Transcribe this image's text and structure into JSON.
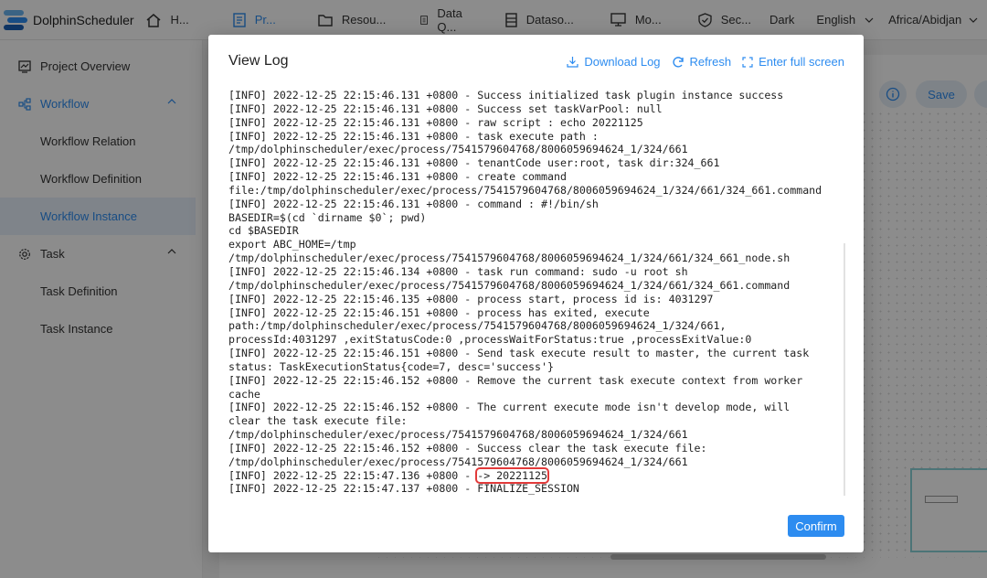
{
  "app": {
    "name": "DolphinScheduler"
  },
  "topnav": {
    "items": [
      {
        "label": "H...",
        "icon": "home-icon"
      },
      {
        "label": "Pr...",
        "icon": "project-icon"
      },
      {
        "label": "Resou...",
        "icon": "folder-icon"
      },
      {
        "label": "Data Q...",
        "icon": "data-quality-icon"
      },
      {
        "label": "Dataso...",
        "icon": "datasource-icon"
      },
      {
        "label": "Mo...",
        "icon": "monitor-icon"
      },
      {
        "label": "Sec...",
        "icon": "security-icon"
      }
    ],
    "theme": "Dark",
    "language": "English",
    "timezone": "Africa/Abidjan"
  },
  "sidebar": {
    "project_overview": "Project Overview",
    "workflow": "Workflow",
    "workflow_relation": "Workflow Relation",
    "workflow_definition": "Workflow Definition",
    "workflow_instance": "Workflow Instance",
    "task": "Task",
    "task_definition": "Task Definition",
    "task_instance": "Task Instance"
  },
  "background": {
    "save_label": "Save"
  },
  "modal": {
    "title": "View Log",
    "download_label": "Download Log",
    "refresh_label": "Refresh",
    "fullscreen_label": "Enter full screen",
    "confirm_label": "Confirm",
    "log_lines": [
      "[INFO] 2022-12-25 22:15:46.131 +0800 - Success initialized task plugin instance success",
      "[INFO] 2022-12-25 22:15:46.131 +0800 - Success set taskVarPool: null",
      "[INFO] 2022-12-25 22:15:46.131 +0800 - raw script : echo 20221125",
      "[INFO] 2022-12-25 22:15:46.131 +0800 - task execute path :",
      "/tmp/dolphinscheduler/exec/process/7541579604768/8006059694624_1/324/661",
      "[INFO] 2022-12-25 22:15:46.131 +0800 - tenantCode user:root, task dir:324_661",
      "[INFO] 2022-12-25 22:15:46.131 +0800 - create command",
      "file:/tmp/dolphinscheduler/exec/process/7541579604768/8006059694624_1/324/661/324_661.command",
      "[INFO] 2022-12-25 22:15:46.131 +0800 - command : #!/bin/sh",
      "BASEDIR=$(cd `dirname $0`; pwd)",
      "cd $BASEDIR",
      "export ABC_HOME=/tmp",
      "/tmp/dolphinscheduler/exec/process/7541579604768/8006059694624_1/324/661/324_661_node.sh",
      "[INFO] 2022-12-25 22:15:46.134 +0800 - task run command: sudo -u root sh",
      "/tmp/dolphinscheduler/exec/process/7541579604768/8006059694624_1/324/661/324_661.command",
      "[INFO] 2022-12-25 22:15:46.135 +0800 - process start, process id is: 4031297",
      "[INFO] 2022-12-25 22:15:46.151 +0800 - process has exited, execute",
      "path:/tmp/dolphinscheduler/exec/process/7541579604768/8006059694624_1/324/661,",
      "processId:4031297 ,exitStatusCode:0 ,processWaitForStatus:true ,processExitValue:0",
      "[INFO] 2022-12-25 22:15:46.151 +0800 - Send task execute result to master, the current task",
      "status: TaskExecutionStatus{code=7, desc='success'}",
      "[INFO] 2022-12-25 22:15:46.152 +0800 - Remove the current task execute context from worker",
      "cache",
      "[INFO] 2022-12-25 22:15:46.152 +0800 - The current execute mode isn't develop mode, will",
      "clear the task execute file:",
      "/tmp/dolphinscheduler/exec/process/7541579604768/8006059694624_1/324/661",
      "[INFO] 2022-12-25 22:15:46.152 +0800 - Success clear the task execute file:",
      "/tmp/dolphinscheduler/exec/process/7541579604768/8006059694624_1/324/661"
    ],
    "highlight_prefix": "[INFO] 2022-12-25 22:15:47.136 +0800 - ",
    "highlight_value": "-> 20221125",
    "last_line": "[INFO] 2022-12-25 22:15:47.137 +0800 - FINALIZE_SESSION"
  }
}
